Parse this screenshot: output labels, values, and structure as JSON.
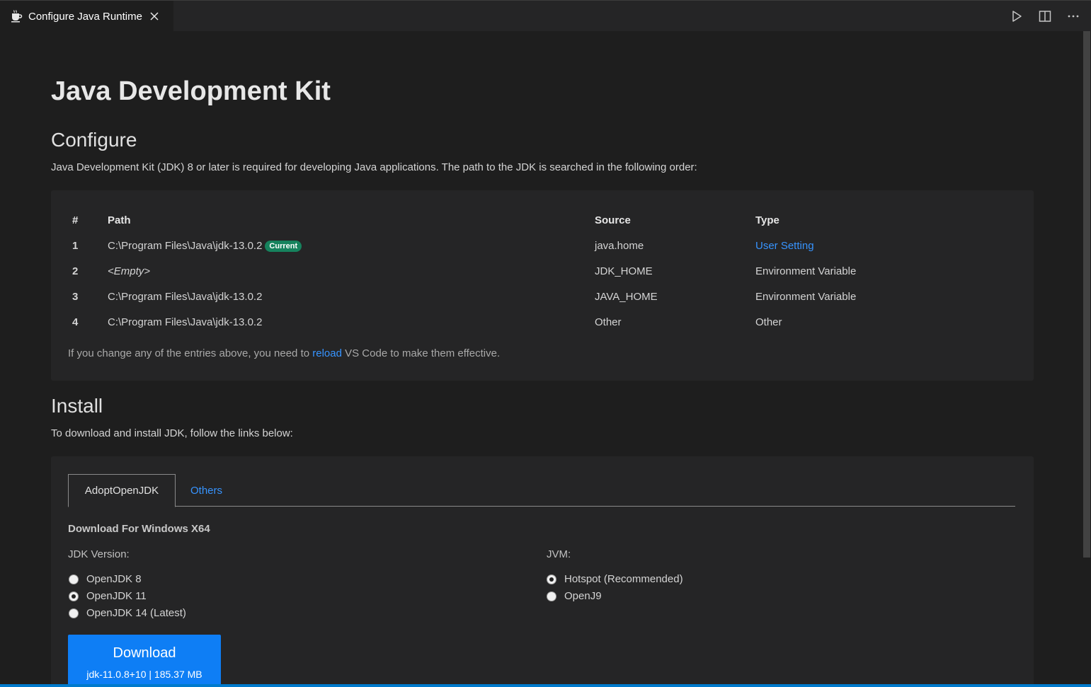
{
  "tab": {
    "title": "Configure Java Runtime"
  },
  "page": {
    "title": "Java Development Kit",
    "configure": {
      "heading": "Configure",
      "description": "Java Development Kit (JDK) 8 or later is required for developing Java applications. The path to the JDK is searched in the following order:",
      "columns": [
        "#",
        "Path",
        "Source",
        "Type"
      ],
      "rows": [
        {
          "num": "1",
          "path": "C:\\Program Files\\Java\\jdk-13.0.2",
          "badge": "Current",
          "source": "java.home",
          "type": "User Setting"
        },
        {
          "num": "2",
          "path": "<Empty>",
          "source": "JDK_HOME",
          "type": "Environment Variable"
        },
        {
          "num": "3",
          "path": "C:\\Program Files\\Java\\jdk-13.0.2",
          "source": "JAVA_HOME",
          "type": "Environment Variable"
        },
        {
          "num": "4",
          "path": "C:\\Program Files\\Java\\jdk-13.0.2",
          "source": "Other",
          "type": "Other"
        }
      ],
      "note_before": "If you change any of the entries above, you need to ",
      "note_link": "reload",
      "note_after": " VS Code to make them effective."
    },
    "install": {
      "heading": "Install",
      "description": "To download and install JDK, follow the links below:",
      "tabs": [
        "AdoptOpenJDK",
        "Others"
      ],
      "download_title": "Download For Windows X64",
      "jdk_label": "JDK Version:",
      "jdk_options": [
        "OpenJDK 8",
        "OpenJDK 11",
        "OpenJDK 14 (Latest)"
      ],
      "jdk_selected": "OpenJDK 11",
      "jvm_label": "JVM:",
      "jvm_options": [
        "Hotspot (Recommended)",
        "OpenJ9"
      ],
      "jvm_selected": "Hotspot (Recommended)",
      "download_button": "Download",
      "download_detail": "jdk-11.0.8+10 | 185.37 MB"
    }
  },
  "colors": {
    "background": "#1e1e1e",
    "panel": "#252526",
    "link": "#3794ff",
    "badge": "#16825d",
    "button": "#0e7ef5"
  },
  "icons": {
    "tab": "java-coffee-icon",
    "close": "close-icon",
    "run": "run-icon",
    "split": "split-editor-icon",
    "more": "more-actions-icon"
  }
}
